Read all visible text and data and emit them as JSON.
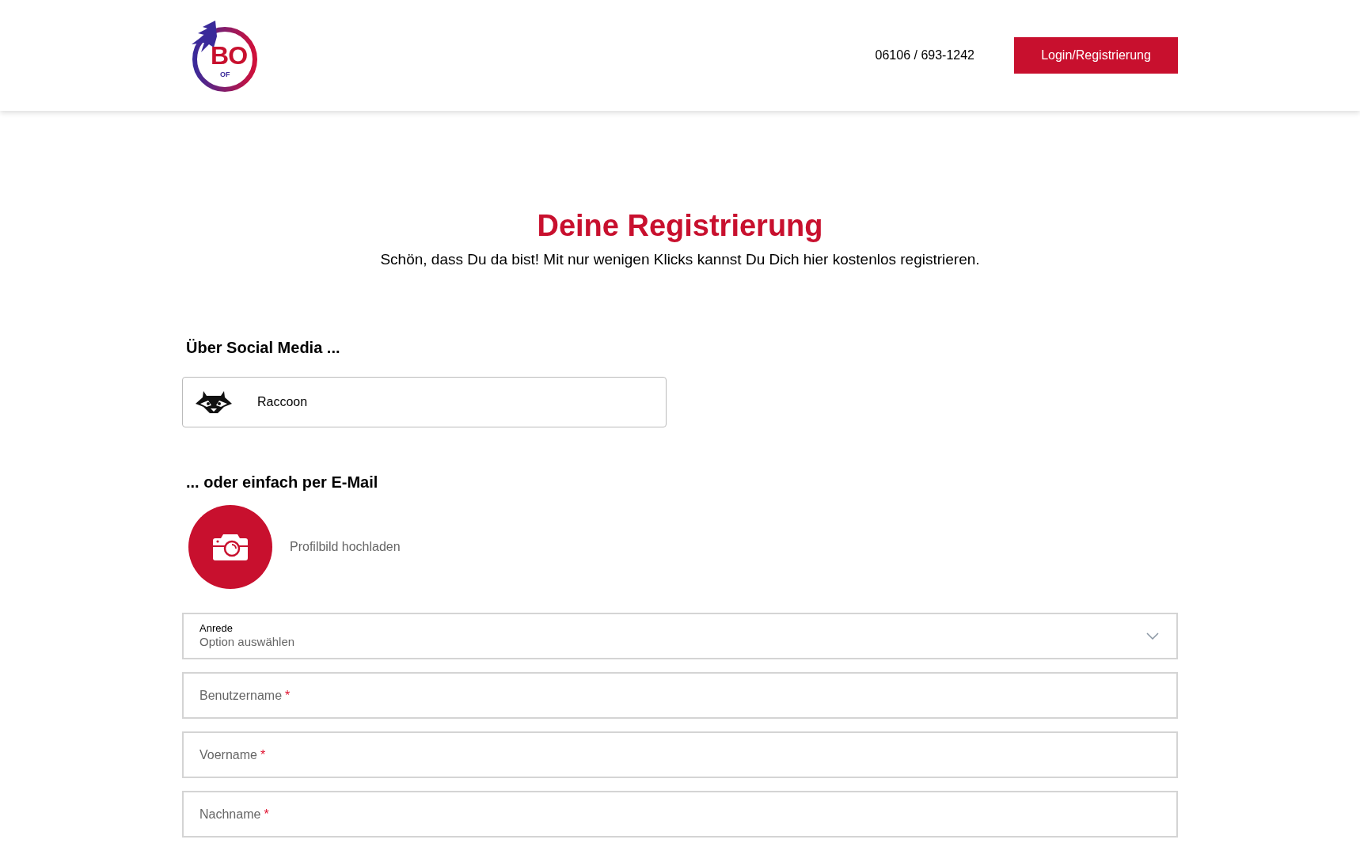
{
  "header": {
    "logo": {
      "main": "BO",
      "sub": "OF"
    },
    "phone": "06106 / 693-1242",
    "login_button": "Login/Registrierung"
  },
  "title": "Deine Registrierung",
  "subtitle": "Schön, dass Du da bist! Mit nur wenigen Klicks kannst Du Dich hier kostenlos registrieren.",
  "social": {
    "heading": "Über Social Media ...",
    "providers": [
      {
        "label": "Raccoon"
      }
    ]
  },
  "email": {
    "heading": "... oder einfach per E-Mail",
    "upload_label": "Profilbild hochladen",
    "fields": [
      {
        "kind": "select",
        "label": "Anrede",
        "placeholder": "Option auswählen"
      },
      {
        "kind": "text",
        "placeholder": "Benutzername",
        "required_mark": "*"
      },
      {
        "kind": "text",
        "placeholder": "Voername",
        "required_mark": "*"
      },
      {
        "kind": "text",
        "placeholder": "Nachname",
        "required_mark": "*"
      }
    ]
  }
}
